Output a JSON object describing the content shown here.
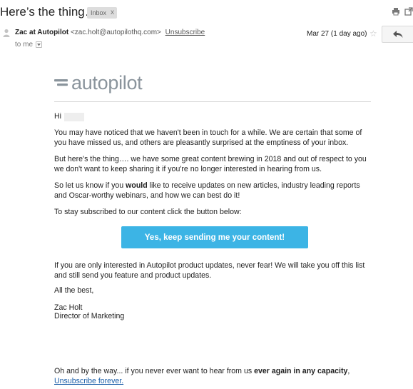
{
  "subject": "Here’s the thing….",
  "label": {
    "text": "Inbox",
    "close": "x"
  },
  "header": {
    "sender_name": "Zac at Autopilot",
    "sender_email": "<zac.holt@autopilothq.com>",
    "unsubscribe": "Unsubscribe",
    "to": "to me",
    "date": "Mar 27 (1 day ago)"
  },
  "body": {
    "logo_text": "autopilot",
    "greeting": "Hi",
    "p1": "You may have noticed that we haven't been in touch for a while. We are certain that some of you have missed us, and others are pleasantly surprised at the emptiness of your inbox.",
    "p2": "But here's the thing…. we have some great content brewing in 2018 and out of respect to you we don't want to keep sharing it if you're no longer interested in hearing from us.",
    "p3_a": "So let us know if you ",
    "p3_b": "would",
    "p3_c": " like to receive updates on new articles, industry leading reports and Oscar-worthy webinars, and how we can best do it!",
    "p4": "To stay subscribed to our content click the button below:",
    "cta": "Yes, keep sending me your content!",
    "p5": "If you are only interested in Autopilot product updates, never fear! We will take you off this list and still send you feature and product updates.",
    "signoff": "All the best,",
    "sig_name": "Zac Holt",
    "sig_title": "Director of Marketing",
    "p6_a": "Oh and by the way... if you never ever want to hear from us ",
    "p6_b": "ever again in any capacity",
    "p6_c": ",",
    "unsub_forever": "Unsubscribe forever."
  },
  "icons": {
    "print": "print-icon",
    "expand": "new-window-icon",
    "star": "star-icon",
    "reply": "reply-icon",
    "avatar": "person-icon",
    "caret": "chevron-down-icon"
  },
  "colors": {
    "cta": "#3cb4e5",
    "logo": "#8a949c",
    "link": "#1a5ea8",
    "chip": "#dddddd"
  }
}
